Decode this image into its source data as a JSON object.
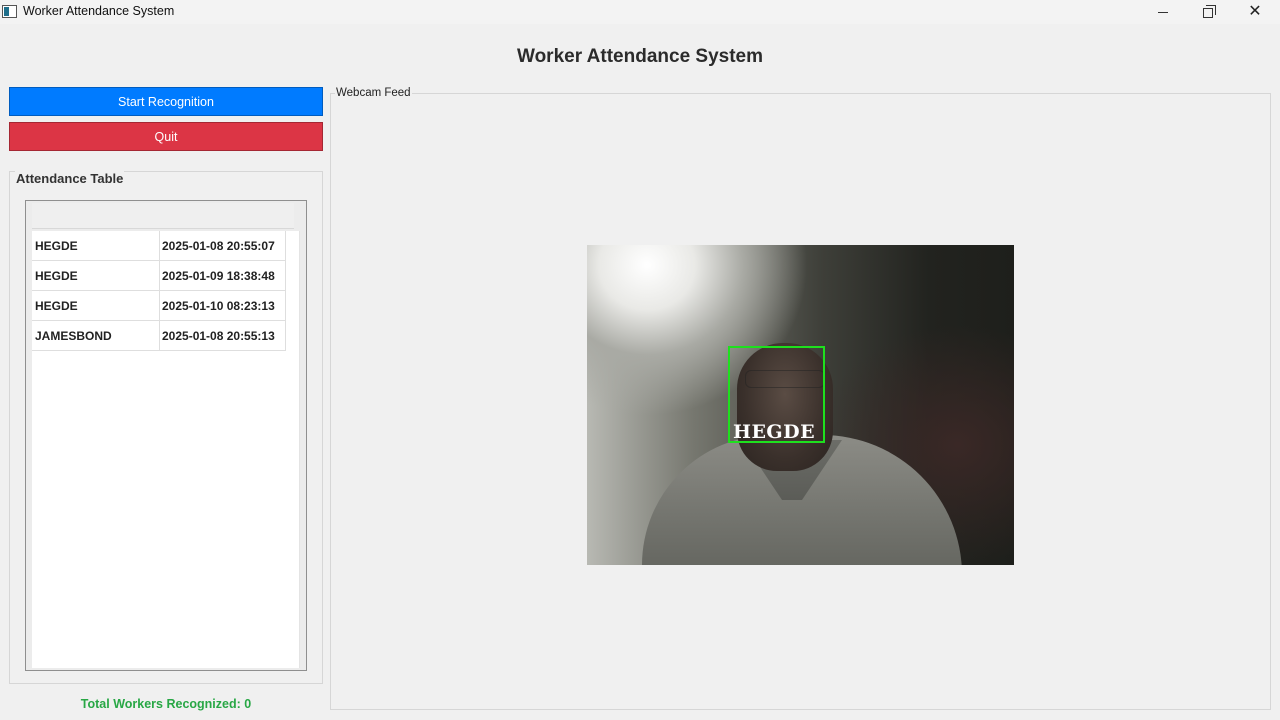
{
  "window": {
    "title": "Worker Attendance System",
    "controls": {
      "minimize": "minimize",
      "maximize": "maximize",
      "close": "✕"
    }
  },
  "header": {
    "title": "Worker Attendance System"
  },
  "buttons": {
    "start_label": "Start Recognition",
    "quit_label": "Quit",
    "start_color": "#007bff",
    "quit_color": "#dc3545"
  },
  "attendance": {
    "group_title": "Attendance Table",
    "rows": [
      {
        "name": "HEGDE",
        "time": "2025-01-08 20:55:07"
      },
      {
        "name": "HEGDE",
        "time": "2025-01-09 18:38:48"
      },
      {
        "name": "HEGDE",
        "time": "2025-01-10 08:23:13"
      },
      {
        "name": "JAMESBOND",
        "time": "2025-01-08 20:55:13"
      }
    ],
    "total_text": "Total Workers Recognized: 0",
    "total_color": "#28a745"
  },
  "webcam": {
    "group_title": "Webcam Feed",
    "detected_label": "HEGDE",
    "box_color": "#1ee01e"
  }
}
